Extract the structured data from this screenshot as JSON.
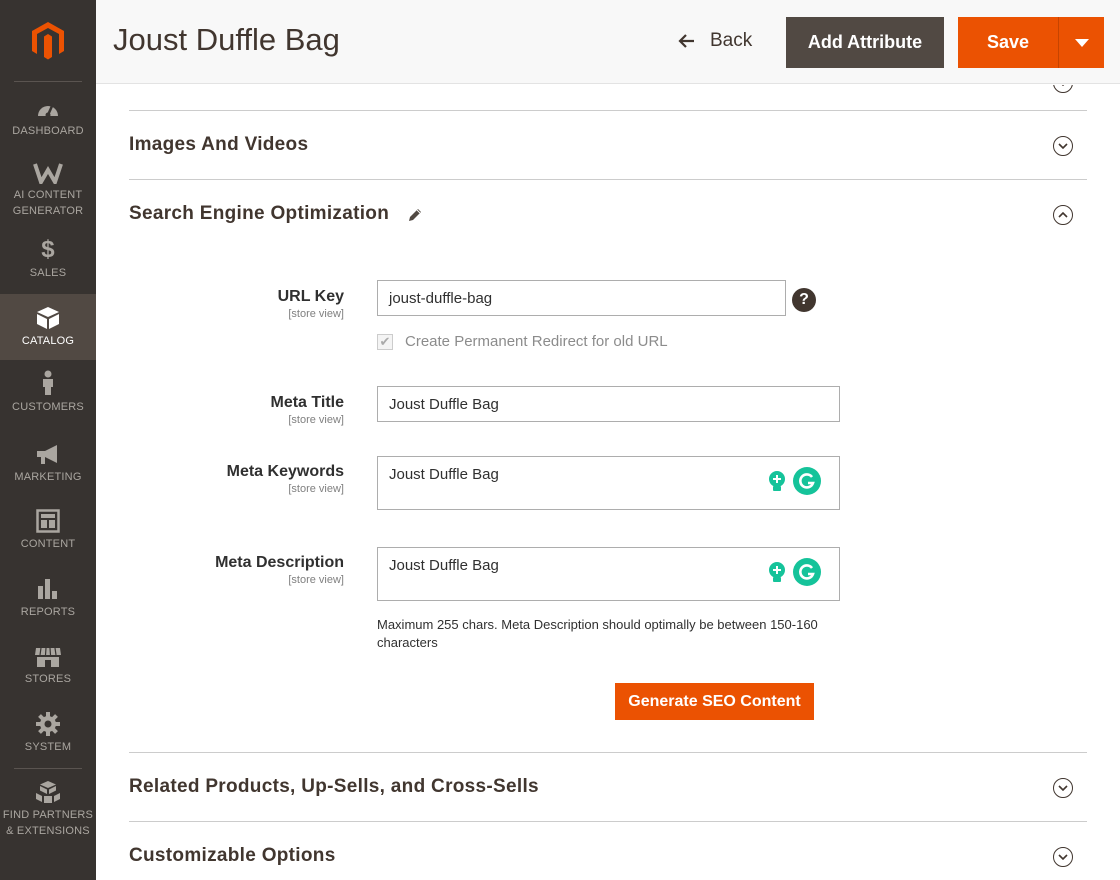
{
  "sidebar": {
    "items": [
      {
        "label": "DASHBOARD",
        "icon": "dashboard-icon"
      },
      {
        "label": "AI CONTENT GENERATOR",
        "icon": "ai-content-generator-icon"
      },
      {
        "label": "SALES",
        "icon": "dollar-icon"
      },
      {
        "label": "CATALOG",
        "icon": "box-icon"
      },
      {
        "label": "CUSTOMERS",
        "icon": "person-icon"
      },
      {
        "label": "MARKETING",
        "icon": "megaphone-icon"
      },
      {
        "label": "CONTENT",
        "icon": "layout-icon"
      },
      {
        "label": "REPORTS",
        "icon": "bar-chart-icon"
      },
      {
        "label": "STORES",
        "icon": "storefront-icon"
      },
      {
        "label": "SYSTEM",
        "icon": "gear-icon"
      },
      {
        "label": "FIND PARTNERS & EXTENSIONS",
        "icon": "cubes-icon"
      }
    ],
    "ai_lines": [
      "AI CONTENT",
      "GENERATOR"
    ],
    "partners_lines": [
      "FIND PARTNERS",
      "& EXTENSIONS"
    ],
    "active": "CATALOG"
  },
  "header": {
    "title": "Joust Duffle Bag",
    "back_label": "Back",
    "add_attribute_label": "Add Attribute",
    "save_label": "Save"
  },
  "sections": {
    "images_videos": "Images And Videos",
    "seo": "Search Engine Optimization",
    "related": "Related Products, Up-Sells, and Cross-Sells",
    "custom_options": "Customizable Options"
  },
  "seo_form": {
    "scope": "[store view]",
    "url_key": {
      "label": "URL Key",
      "value": "joust-duffle-bag"
    },
    "redirect_checkbox": {
      "label": "Create Permanent Redirect for old URL",
      "checked": true
    },
    "meta_title": {
      "label": "Meta Title",
      "value": "Joust Duffle Bag"
    },
    "meta_keywords": {
      "label": "Meta Keywords",
      "value": "Joust Duffle Bag"
    },
    "meta_description": {
      "label": "Meta Description",
      "value": "Joust Duffle Bag"
    },
    "note": "Maximum 255 chars. Meta Description should optimally be between 150-160 characters",
    "generate_button": "Generate SEO Content",
    "help_glyph": "?"
  },
  "colors": {
    "sidebar_bg": "#373330",
    "sidebar_active": "#514943",
    "accent": "#eb5202",
    "dark_button": "#514943",
    "grammarly": "#15c39a"
  }
}
